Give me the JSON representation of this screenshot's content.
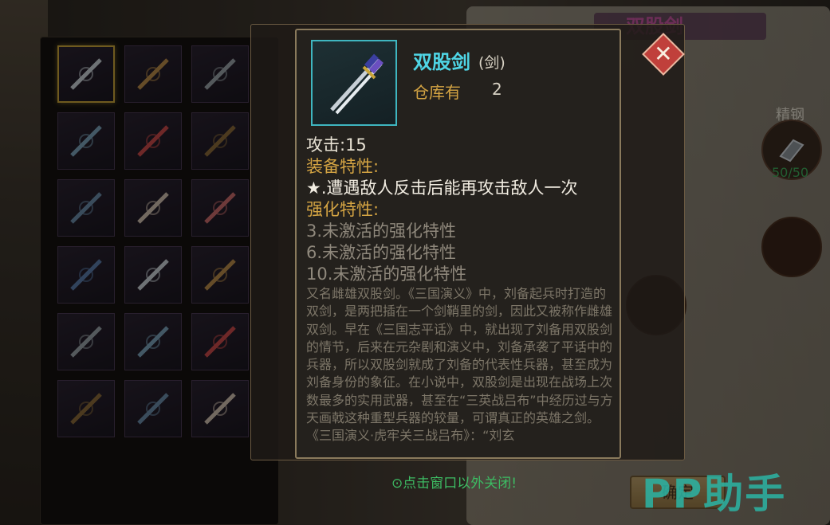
{
  "tooltip": {
    "item_name": "双股剑",
    "item_type": "(剑)",
    "stock_label": "仓库有",
    "stock_count": "2",
    "attack": "攻击:15",
    "equip_trait_heading": "装备特性:",
    "equip_trait_effect": "★.遭遇敌人反击后能再攻击敌人一次",
    "refine_heading": "强化特性:",
    "refine_traits": [
      "3.未激活的强化特性",
      "6.未激活的强化特性",
      "10.未激活的强化特性"
    ],
    "description": "又名雌雄双股剑。《三国演义》中，刘备起兵时打造的双剑，是两把插在一个剑鞘里的剑，因此又被称作雌雄双剑。早在《三国志平话》中，就出现了刘备用双股剑的情节，后来在元杂剧和演义中，刘备承袭了平话中的兵器，所以双股剑就成了刘备的代表性兵器，甚至成为刘备身份的象征。在小说中，双股剑是出现在战场上次数最多的实用武器，甚至在“三英战吕布”中经历过与方天画戟这种重型兵器的较量，可谓真正的英雄之剑。《三国演义·虎牢关三战吕布》：“刘玄"
  },
  "close_hint": "⊙点击窗口以外关闭!",
  "right_panel": {
    "title": "双股剑",
    "material_label": "精钢",
    "material_count": "50/50",
    "confirm_label": "确定"
  },
  "watermark": "PP助手",
  "inventory_slots": [
    {
      "icon": "sword-icon",
      "selected": true
    },
    {
      "icon": "claw-weapon-icon"
    },
    {
      "icon": "spear-icon"
    },
    {
      "icon": "hook-blade-icon"
    },
    {
      "icon": "halberd-icon"
    },
    {
      "icon": "red-tassel-spear-icon"
    },
    {
      "icon": "broad-blade-icon"
    },
    {
      "icon": "bow-icon"
    },
    {
      "icon": "crossbow-icon"
    },
    {
      "icon": "mace-icon"
    },
    {
      "icon": "feather-fan-icon"
    },
    {
      "icon": "red-feather-fan-icon"
    },
    {
      "icon": "blue-armor-icon"
    },
    {
      "icon": "gold-armor-icon"
    },
    {
      "icon": "bronze-armor-icon"
    },
    {
      "icon": "silver-robe-icon"
    },
    {
      "icon": "red-robe-icon"
    },
    {
      "icon": "blue-robe-icon"
    }
  ],
  "colors": {
    "name": "#4fd6e6",
    "heading": "#d4a443",
    "inactive": "#8f887c",
    "hint": "#3dbb63"
  }
}
